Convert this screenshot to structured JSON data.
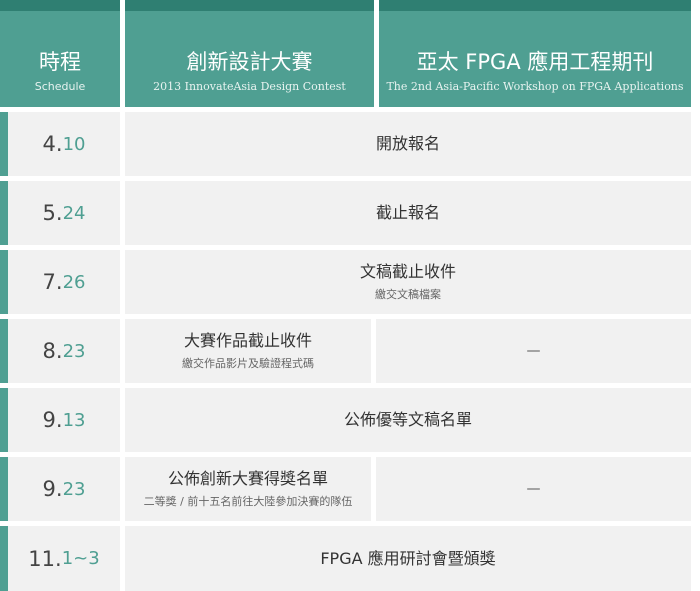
{
  "header": {
    "schedule": {
      "title": "時程",
      "subtitle": "Schedule"
    },
    "contest": {
      "title": "創新設計大賽",
      "subtitle": "2013 InnovateAsia Design Contest"
    },
    "fpga": {
      "title": "亞太  FPGA 應用工程期刊",
      "subtitle": "The 2nd Asia-Pacific Workshop on FPGA Applications"
    }
  },
  "rows": [
    {
      "date_main": "4.",
      "date_suffix": "10",
      "text": "開放報名"
    },
    {
      "date_main": "5.",
      "date_suffix": "24",
      "text": "截止報名"
    },
    {
      "date_main": "7.",
      "date_suffix": "26",
      "text": "文稿截止收件",
      "note": "繳交文稿檔案"
    },
    {
      "date_main": "8.",
      "date_suffix": "23",
      "contest_text": "大賽作品截止收件",
      "contest_note": "繳交作品影片及驗證程式碼",
      "fpga_text": "—"
    },
    {
      "date_main": "9.",
      "date_suffix": "13",
      "text": "公佈優等文稿名單"
    },
    {
      "date_main": "9.",
      "date_suffix": "23",
      "contest_text": "公佈創新大賽得獎名單",
      "contest_note": "二等獎 / 前十五名前往大陸參加決賽的隊伍",
      "fpga_text": "—"
    },
    {
      "date_main": "11.",
      "date_suffix": "1~3",
      "text": "FPGA  應用研討會暨頒獎"
    }
  ],
  "colors": {
    "teal": "#4f9f92",
    "teal_dark": "#2f7f72",
    "row_bg": "#f1f1f1"
  }
}
